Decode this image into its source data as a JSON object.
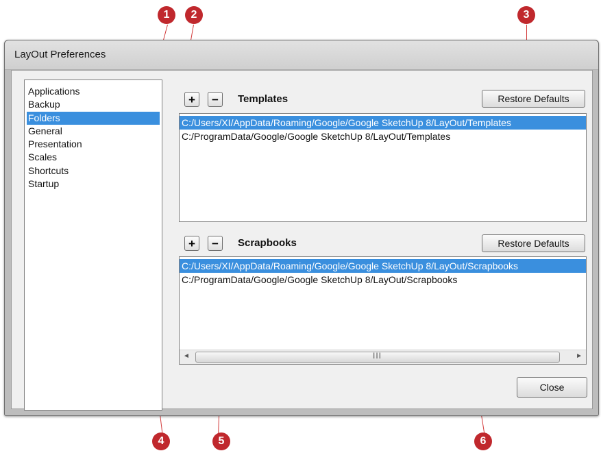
{
  "window": {
    "title": "LayOut Preferences"
  },
  "categories": [
    {
      "label": "Applications"
    },
    {
      "label": "Backup"
    },
    {
      "label": "Folders",
      "selected": true
    },
    {
      "label": "General"
    },
    {
      "label": "Presentation"
    },
    {
      "label": "Scales"
    },
    {
      "label": "Shortcuts"
    },
    {
      "label": "Startup"
    }
  ],
  "templates": {
    "add_label": "+",
    "remove_label": "−",
    "heading": "Templates",
    "restore_label": "Restore Defaults",
    "paths": [
      "C:/Users/XI/AppData/Roaming/Google/Google SketchUp 8/LayOut/Templates",
      "C:/ProgramData/Google/Google SketchUp 8/LayOut/Templates"
    ]
  },
  "scrapbooks": {
    "add_label": "+",
    "remove_label": "−",
    "heading": "Scrapbooks",
    "restore_label": "Restore Defaults",
    "paths": [
      "C:/Users/XI/AppData/Roaming/Google/Google SketchUp 8/LayOut/Scrapbooks",
      "C:/ProgramData/Google/Google SketchUp 8/LayOut/Scrapbooks"
    ],
    "scroll_left_icon": "◄",
    "scroll_right_icon": "►",
    "scroll_grip": "III"
  },
  "footer": {
    "close_label": "Close"
  },
  "callouts": [
    "1",
    "2",
    "3",
    "4",
    "5",
    "6"
  ],
  "colors": {
    "selection": "#3a8fde",
    "callout": "#c0282d"
  }
}
